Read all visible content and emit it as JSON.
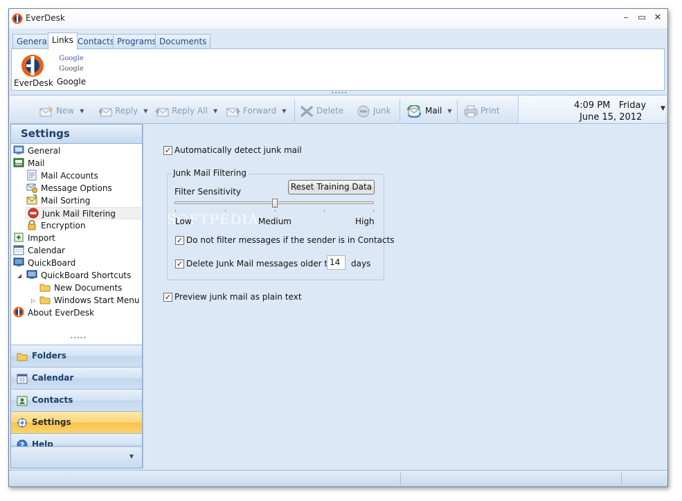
{
  "window": {
    "title": "EverDesk",
    "minimize_glyph": "–",
    "maximize_glyph": "▭",
    "close_glyph": "✕"
  },
  "tabs": [
    {
      "label": "General"
    },
    {
      "label": "Links"
    },
    {
      "label": "Contacts"
    },
    {
      "label": "Programs"
    },
    {
      "label": "Documents"
    }
  ],
  "links": [
    {
      "label": "EverDesk",
      "icon": "everdesk-logo-icon"
    },
    {
      "label": "Google",
      "icon": "google-logo-icon",
      "logo_text": "Google"
    }
  ],
  "toolbar": {
    "new_label": "New",
    "reply_label": "Reply",
    "reply_all_label": "Reply All",
    "forward_label": "Forward",
    "delete_label": "Delete",
    "junk_label": "Junk",
    "mail_label": "Mail",
    "print_label": "Print",
    "clock_time": "4:09 PM   Friday",
    "clock_date": "June 15, 2012"
  },
  "settings": {
    "header": "Settings",
    "tree": [
      {
        "label": "General",
        "icon": "general-settings-icon"
      },
      {
        "label": "Mail",
        "icon": "mail-icon"
      },
      {
        "label": "Mail Accounts",
        "icon": "mail-accounts-icon"
      },
      {
        "label": "Message Options",
        "icon": "message-options-icon"
      },
      {
        "label": "Mail Sorting",
        "icon": "mail-sorting-icon"
      },
      {
        "label": "Junk Mail Filtering",
        "icon": "junk-filter-icon",
        "selected": true
      },
      {
        "label": "Encryption",
        "icon": "lock-icon"
      },
      {
        "label": "Import",
        "icon": "import-icon"
      },
      {
        "label": "Calendar",
        "icon": "calendar-icon"
      },
      {
        "label": "QuickBoard",
        "icon": "quickboard-icon"
      },
      {
        "label": "QuickBoard Shortcuts",
        "icon": "monitor-icon"
      },
      {
        "label": "New Documents",
        "icon": "folder-icon"
      },
      {
        "label": "Windows Start Menu",
        "icon": "folder-icon"
      },
      {
        "label": "About EverDesk",
        "icon": "everdesk-logo-icon"
      }
    ]
  },
  "nav": [
    {
      "label": "Folders",
      "icon": "folders-icon"
    },
    {
      "label": "Calendar",
      "icon": "calendar-icon"
    },
    {
      "label": "Contacts",
      "icon": "contacts-icon"
    },
    {
      "label": "Settings",
      "icon": "settings-icon",
      "selected": true
    },
    {
      "label": "Help",
      "icon": "help-icon"
    }
  ],
  "junk": {
    "auto_detect_label": "Automatically detect junk mail",
    "auto_detect_checked": true,
    "group_title": "Junk Mail Filtering",
    "reset_button": "Reset Training Data",
    "sensitivity_label": "Filter Sensitivity",
    "sensitivity_level": "Medium",
    "slider_low": "Low",
    "slider_medium": "Medium",
    "slider_high": "High",
    "watermark": "SOFTPEDIA",
    "no_filter_contacts_label": "Do not filter messages if the sender is in Contacts",
    "no_filter_contacts_checked": true,
    "delete_older_label": "Delete Junk Mail messages older than",
    "delete_older_checked": true,
    "delete_days_value": "14",
    "days_label": "days",
    "preview_plain_label": "Preview junk mail as plain text",
    "preview_plain_checked": true
  },
  "colors": {
    "accent": "#1e3e6b",
    "selected_nav": "#f8c24b",
    "window_bg": "#dce8f5"
  }
}
